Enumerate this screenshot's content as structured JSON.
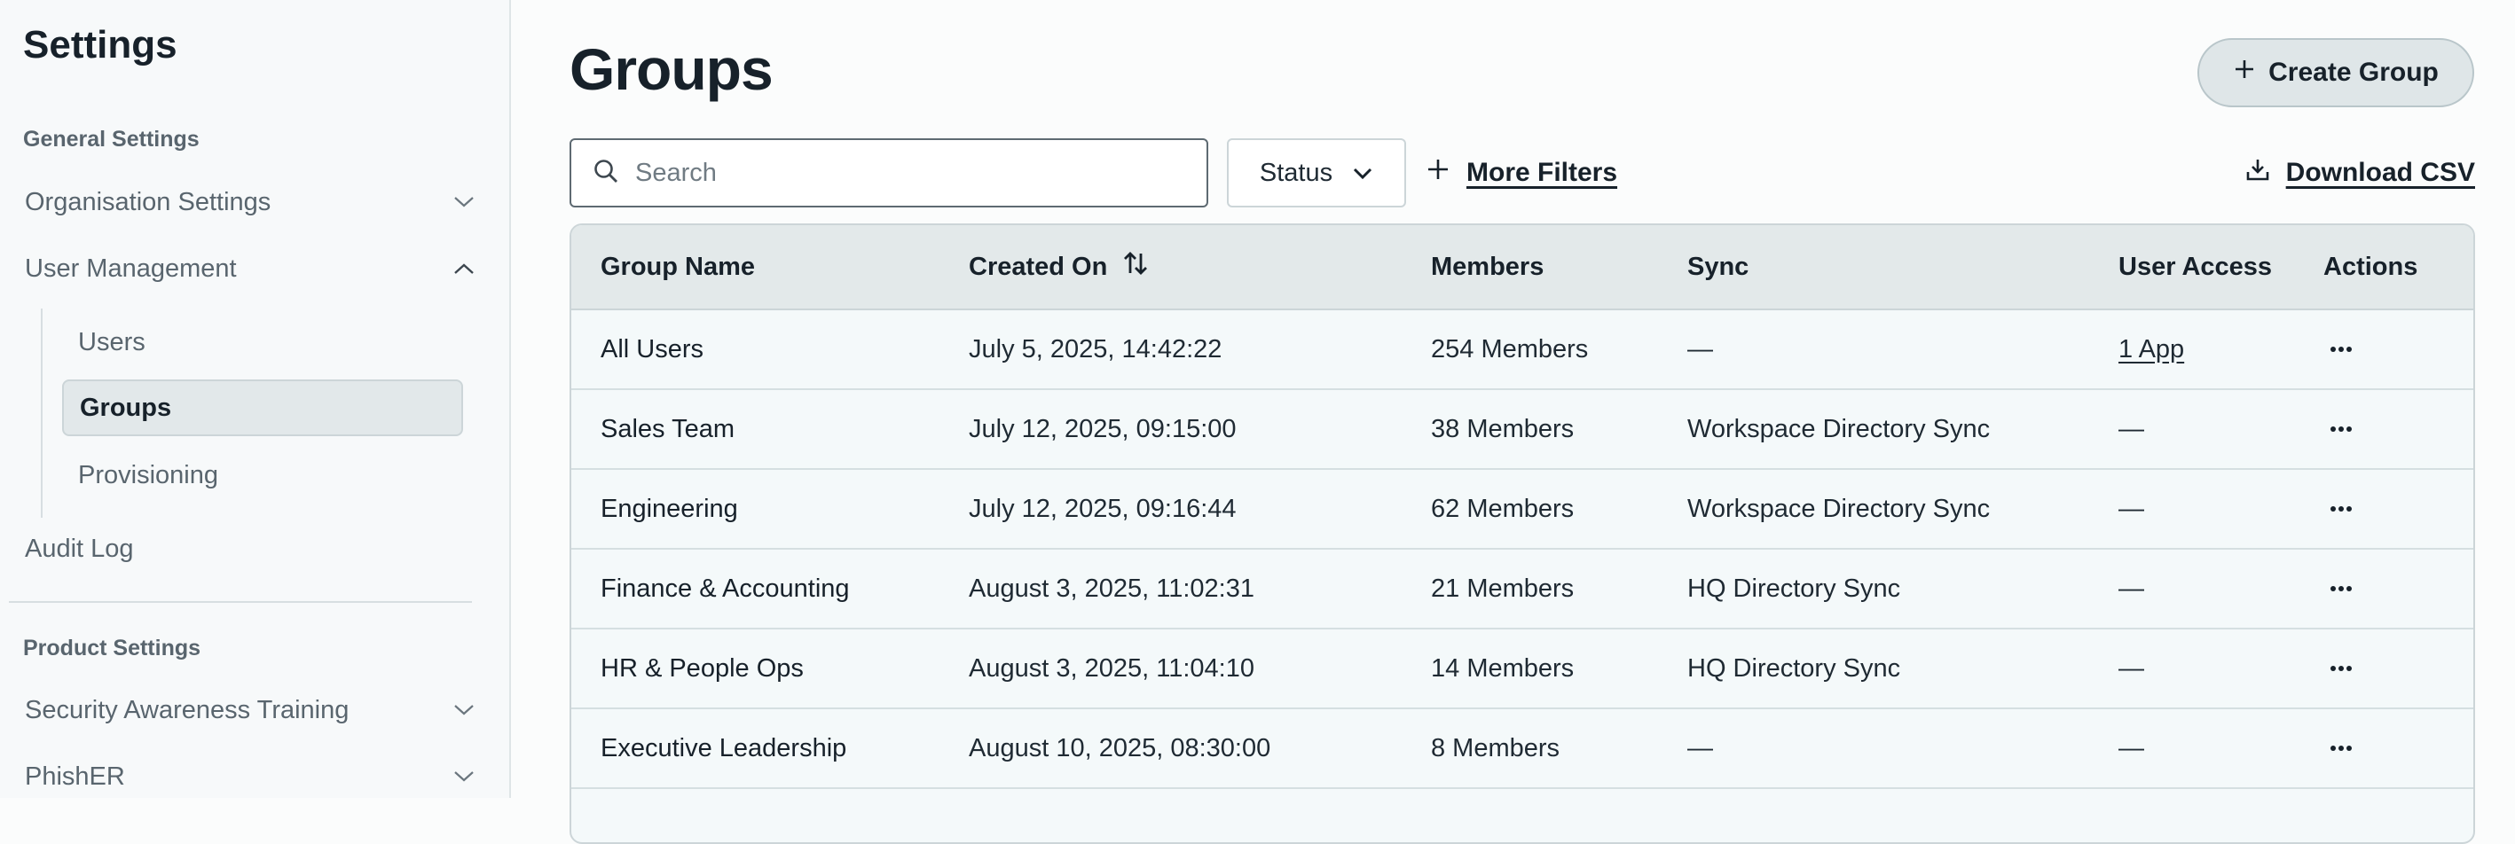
{
  "sidebar": {
    "title": "Settings",
    "general_section": "General Settings",
    "items": [
      {
        "label": "Organisation Settings",
        "expanded": false
      },
      {
        "label": "User Management",
        "expanded": true
      }
    ],
    "sub_items": [
      {
        "label": "Users",
        "active": false
      },
      {
        "label": "Groups",
        "active": true
      },
      {
        "label": "Provisioning",
        "active": false
      }
    ],
    "audit_log": "Audit Log",
    "product_section": "Product Settings",
    "product_items": [
      {
        "label": "Security Awareness Training",
        "expanded": false
      },
      {
        "label": "PhishER",
        "expanded": false
      }
    ]
  },
  "header": {
    "title": "Groups",
    "create_label": "Create Group"
  },
  "toolbar": {
    "search_placeholder": "Search",
    "status_label": "Status",
    "more_filters_label": "More Filters",
    "download_label": "Download CSV"
  },
  "table": {
    "columns": [
      "Group Name",
      "Created On",
      "Members",
      "Sync",
      "User Access",
      "Actions"
    ],
    "rows": [
      {
        "name": "All Users",
        "created": "July 5, 2025, 14:42:22",
        "members": "254 Members",
        "sync": "—",
        "access": "1 App"
      },
      {
        "name": "Sales Team",
        "created": "July 12, 2025, 09:15:00",
        "members": "38 Members",
        "sync": "Workspace Directory Sync",
        "access": "—"
      },
      {
        "name": "Engineering",
        "created": "July 12, 2025, 09:16:44",
        "members": "62 Members",
        "sync": "Workspace Directory Sync",
        "access": "—"
      },
      {
        "name": "Finance & Accounting",
        "created": "August 3, 2025, 11:02:31",
        "members": "21 Members",
        "sync": "HQ Directory Sync",
        "access": "—"
      },
      {
        "name": "HR & People Ops",
        "created": "August 3, 2025, 11:04:10",
        "members": "14 Members",
        "sync": "HQ Directory Sync",
        "access": "—"
      },
      {
        "name": "Executive Leadership",
        "created": "August 10, 2025, 08:30:00",
        "members": "8 Members",
        "sync": "—",
        "access": "—"
      }
    ]
  },
  "colors": {
    "primary_text": "#17212a",
    "muted_text": "#59656e",
    "active_bg": "#e2e8ea",
    "table_header_bg": "#e3e9ea",
    "row_bg": "#f4f9fa"
  }
}
